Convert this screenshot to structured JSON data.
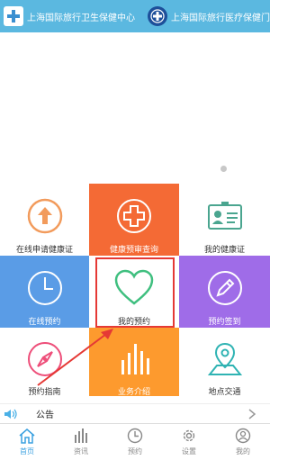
{
  "header": {
    "left_title": "上海国际旅行卫生保健中心",
    "right_title": "上海国际旅行医疗保健门诊部"
  },
  "tiles": [
    {
      "label": "在线申请健康证",
      "icon": "upload-icon"
    },
    {
      "label": "健康预审查询",
      "icon": "medical-cross-icon"
    },
    {
      "label": "我的健康证",
      "icon": "id-card-icon"
    },
    {
      "label": "在线预约",
      "icon": "clock-icon"
    },
    {
      "label": "我的预约",
      "icon": "heart-icon"
    },
    {
      "label": "预约签到",
      "icon": "pencil-icon"
    },
    {
      "label": "预约指南",
      "icon": "compass-icon"
    },
    {
      "label": "业务介绍",
      "icon": "bar-chart-icon"
    },
    {
      "label": "地点交通",
      "icon": "map-pin-icon"
    }
  ],
  "notice": {
    "label": "公告"
  },
  "tabs": [
    {
      "label": "首页",
      "icon": "home-icon",
      "active": true
    },
    {
      "label": "资讯",
      "icon": "news-icon",
      "active": false
    },
    {
      "label": "预约",
      "icon": "clock-icon",
      "active": false
    },
    {
      "label": "设置",
      "icon": "gear-icon",
      "active": false
    },
    {
      "label": "我的",
      "icon": "user-icon",
      "active": false
    }
  ],
  "colors": {
    "header": "#5bb8e0",
    "orange": "#f46a35",
    "blue": "#5a9ce6",
    "purple": "#9f6ce8",
    "amber": "#fd9a2e",
    "highlight": "#e53935",
    "tab_active": "#3aa0e0"
  }
}
